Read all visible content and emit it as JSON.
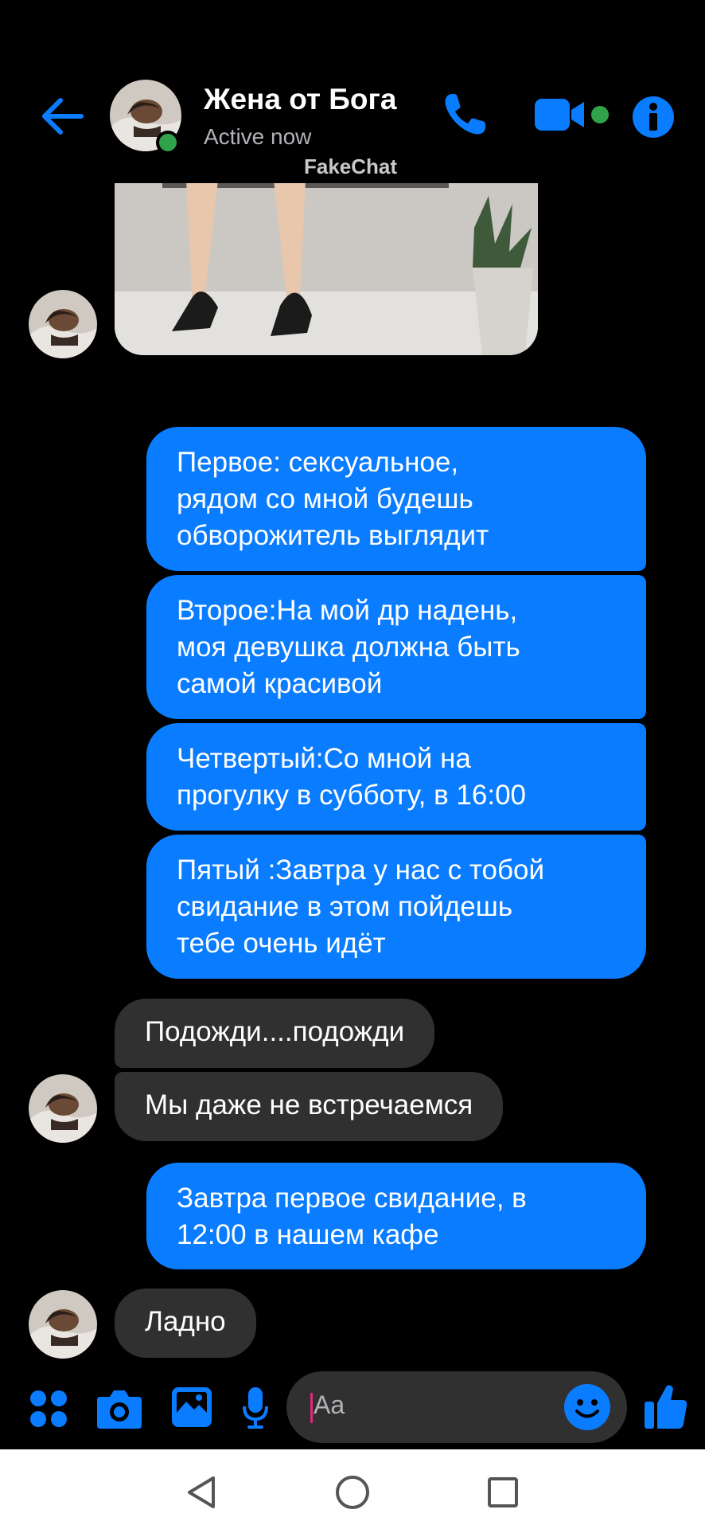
{
  "header": {
    "contact_name": "Жена от Бога",
    "status": "Active now",
    "watermark": "FakeChat"
  },
  "messages": {
    "m1": {
      "from": "me",
      "lines": [
        "Первое: сексуальное,",
        "рядом со мной будешь",
        "обворожитель выглядит"
      ]
    },
    "m2": {
      "from": "me",
      "lines": [
        "Второе:На мой др надень,",
        "моя девушка должна быть",
        "самой красивой"
      ]
    },
    "m3": {
      "from": "me",
      "lines": [
        "Четвертый:Со мной на",
        "прогулку в субботу, в 16:00"
      ]
    },
    "m4": {
      "from": "me",
      "lines": [
        "Пятый :Завтра у нас с тобой",
        "свидание в этом пойдешь",
        "тебе очень идёт"
      ]
    },
    "m5": {
      "from": "contact",
      "text": "Подожди....подожди"
    },
    "m6": {
      "from": "contact",
      "text": "Мы даже не встречаемся"
    },
    "m7": {
      "from": "me",
      "lines": [
        "Завтра первое свидание, в",
        "12:00 в нашем кафе"
      ]
    },
    "m8": {
      "from": "contact",
      "text": "Ладно"
    }
  },
  "composer": {
    "placeholder": "Aa",
    "icons": [
      "apps-icon",
      "camera-icon",
      "gallery-icon",
      "microphone-icon",
      "emoji-icon",
      "like-icon"
    ]
  },
  "colors": {
    "accent": "#0a7cff",
    "incoming_bubble": "#303030",
    "background": "#000000",
    "online": "#31a24c"
  }
}
